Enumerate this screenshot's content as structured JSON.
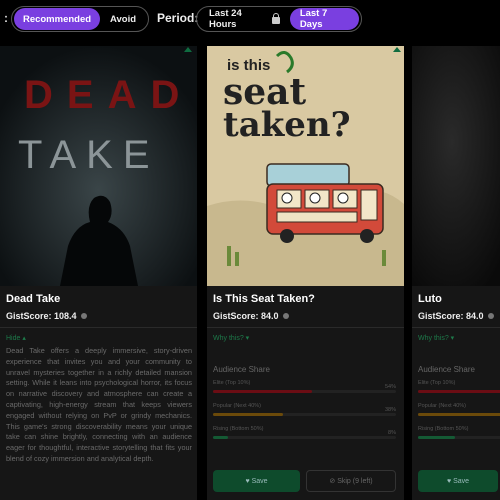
{
  "filters": {
    "colon": ":",
    "mode_options": [
      {
        "label": "Recommended",
        "active": true
      },
      {
        "label": "Avoid",
        "active": false
      }
    ],
    "period_label": "Period:",
    "period_options": [
      {
        "label": "Last 24 Hours",
        "active": false,
        "locked": true
      },
      {
        "label": "Last 7 Days",
        "active": true
      }
    ]
  },
  "cards": [
    {
      "title": "Dead Take",
      "score": "GistScore: 108.4",
      "link": "Hide ▴",
      "poster_text": [
        "DEAD",
        "TAKE"
      ],
      "description": "Dead Take offers a deeply immersive, story-driven experience that invites you and your community to unravel mysteries together in a richly detailed mansion setting. While it leans into psychological horror, its focus on narrative discovery and atmosphere can create a captivating, high-energy stream that keeps viewers engaged without relying on PvP or grindy mechanics. This game's strong discoverability means your unique take can shine brightly, connecting with an audience eager for thoughtful, interactive storytelling that fits your blend of cozy immersion and analytical depth."
    },
    {
      "title": "Is This Seat Taken?",
      "score": "GistScore: 84.0",
      "link": "Why this? ▾",
      "poster_text": [
        "is this",
        "seat",
        "taken?"
      ],
      "audience": {
        "title": "Audience Share",
        "rows": [
          {
            "label": "Elite (Top 10%)",
            "pct": "54%",
            "value": 0.54,
            "color": "#6b0d14"
          },
          {
            "label": "Popular (Next 40%)",
            "pct": "38%",
            "value": 0.38,
            "color": "#6b4a0a"
          },
          {
            "label": "Rising (Bottom 50%)",
            "pct": "8%",
            "value": 0.08,
            "color": "#145a34"
          }
        ]
      },
      "save_label": "♥ Save",
      "skip_label": "⊘ Skip (9 left)"
    },
    {
      "title": "Luto",
      "score": "GistScore: 84.0",
      "link": "Why this? ▾",
      "audience": {
        "title": "Audience Share",
        "rows": [
          {
            "label": "Elite (Top 10%)",
            "value": 0.75,
            "color": "#6b0d14"
          },
          {
            "label": "Popular (Next 40%)",
            "value": 0.55,
            "color": "#6b4a0a"
          },
          {
            "label": "Rising (Bottom 50%)",
            "value": 0.2,
            "color": "#145a34"
          }
        ]
      },
      "save_label": "♥ Save"
    }
  ],
  "colors": {
    "accent": "#7a3fe0",
    "save": "#0e4b2c",
    "link": "#1d7a4a"
  }
}
